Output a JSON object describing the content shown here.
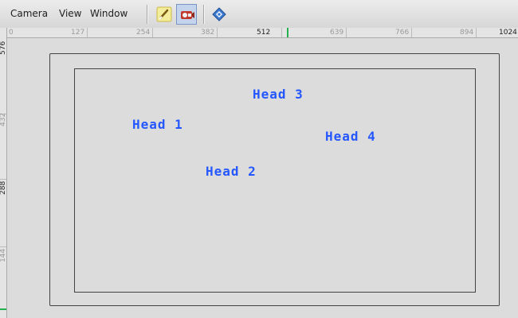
{
  "menu": [
    "Camera",
    "View",
    "Window"
  ],
  "toolbar": {
    "buttons": [
      {
        "name": "brush-tool-icon",
        "active": false
      },
      {
        "name": "camera-projector-icon",
        "active": true
      },
      {
        "name": "navigation-diamond-icon",
        "active": false
      }
    ]
  },
  "ruler": {
    "horizontal": [
      "0",
      "127",
      "254",
      "382",
      "512",
      "639",
      "766",
      "894",
      "1024"
    ],
    "horizontal_current": "512",
    "vertical": [
      "576",
      "432",
      "288",
      "144"
    ]
  },
  "heads": [
    {
      "label": "Head 1"
    },
    {
      "label": "Head 2"
    },
    {
      "label": "Head 3"
    },
    {
      "label": "Head 4"
    }
  ],
  "colors": {
    "head_text": "#2457ff",
    "ruler_marker": "#22b14c"
  }
}
